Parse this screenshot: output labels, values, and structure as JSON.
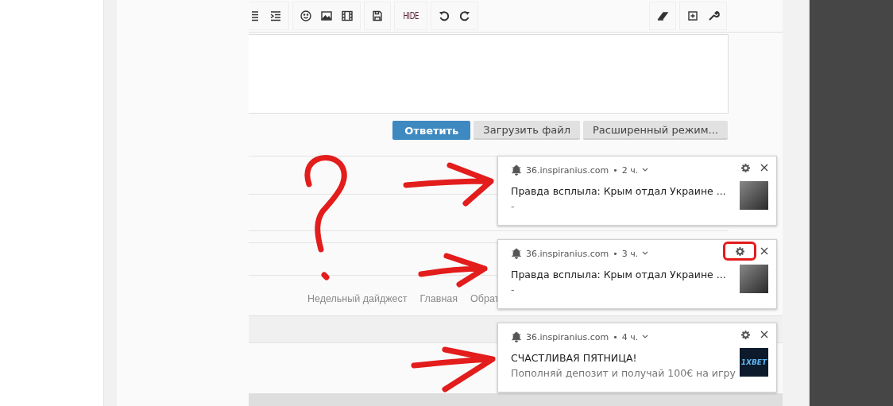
{
  "toolbar": {
    "hide_label": "HIDE"
  },
  "editor": {
    "buttons": [
      {
        "label": "Ответить",
        "kind": "primary"
      },
      {
        "label": "Загрузить файл",
        "kind": "secondary"
      },
      {
        "label": "Расширенный режим...",
        "kind": "secondary"
      }
    ]
  },
  "footer_links": [
    "Недельный дайджест",
    "Главная",
    "Обрат"
  ],
  "notifications": [
    {
      "site": "36.inspiranius.com",
      "separator": "•",
      "time": "2 ч.",
      "title": "Правда всплыла: Крым отдал Украине ...",
      "body": "-",
      "kind": "photo",
      "highlighted": false
    },
    {
      "site": "36.inspiranius.com",
      "separator": "•",
      "time": "3 ч.",
      "title": "Правда всплыла: Крым отдал Украине ...",
      "body": "-",
      "kind": "photo",
      "highlighted": true
    },
    {
      "site": "36.inspiranius.com",
      "separator": "•",
      "time": "4 ч.",
      "title": "СЧАСТЛИВАЯ ПЯТНИЦА!",
      "body": "Пополняй депозит и получай 100€ на игру",
      "kind": "logo",
      "logo_text": "1XBET",
      "highlighted": false
    }
  ]
}
